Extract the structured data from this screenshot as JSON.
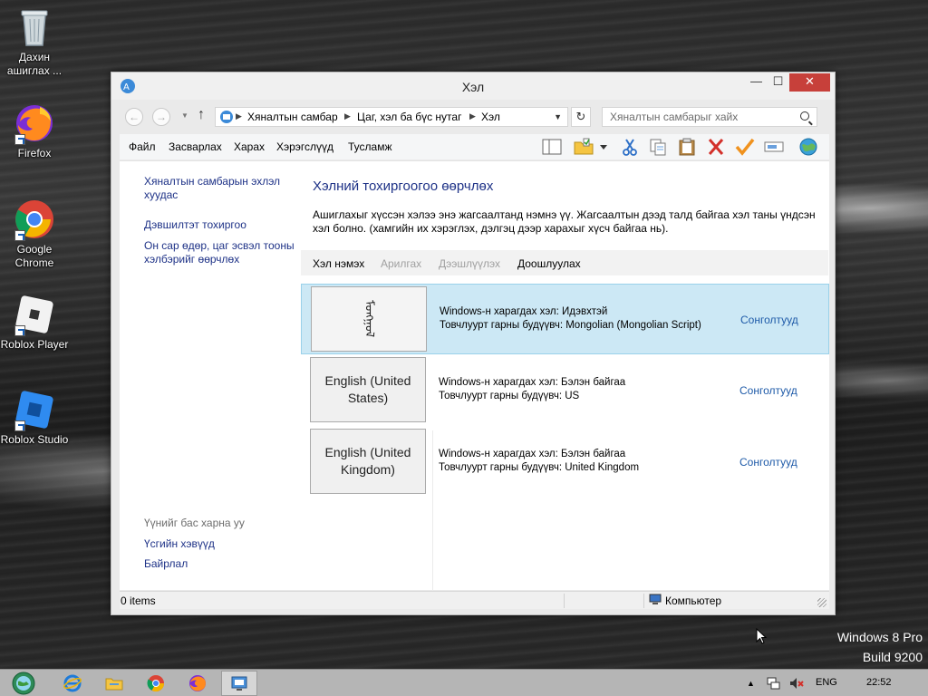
{
  "desktop": {
    "icons": [
      {
        "label": "Дахин ашиглах ..."
      },
      {
        "label": "Firefox"
      },
      {
        "label": "Google Chrome"
      },
      {
        "label": "Roblox Player"
      },
      {
        "label": "Roblox Studio"
      }
    ]
  },
  "window": {
    "title": "Хэл",
    "controls": {
      "minimize": "—",
      "maximize": "☐",
      "close": "✕"
    }
  },
  "address_bar": {
    "back": "←",
    "forward": "→",
    "up": "↑",
    "breadcrumbs": [
      "Хяналтын самбар",
      "Цаг, хэл ба бүс нутаг",
      "Хэл"
    ],
    "refresh": "↻",
    "search_placeholder": "Хяналтын самбарыг хайх"
  },
  "menu": {
    "items": [
      "Файл",
      "Засварлах",
      "Харах",
      "Хэрэгслүүд",
      "Тусламж"
    ]
  },
  "sidebar": {
    "home_link": "Хяналтын самбарын эхлэл хуудас",
    "advanced_link": "Дэвшилтэт тохиргоо",
    "date_format_link": "Он сар өдөр, цаг эсвэл тооны хэлбэрийг өөрчлөх",
    "see_also_heading": "Үүнийг бас харна уу",
    "fonts_link": "Үсгийн хэвүүд",
    "location_link": "Байрлал"
  },
  "main": {
    "title": "Хэлний тохиргоогоо өөрчлөх",
    "description": "Ашиглахыг хүссэн хэлээ энэ жагсаалтанд нэмнэ үү. Жагсаалтын дээд талд байгаа хэл таны үндсэн хэл болно. (хамгийн их хэрэглэх, дэлгэц дээр харахыг хүсч байгаа нь).",
    "commands": {
      "add": "Хэл нэмэх",
      "remove": "Арилгах",
      "move_up": "Дээшлүүлэх",
      "move_down": "Доошлуулах"
    },
    "languages": [
      {
        "button": "ᠮᠣᠩᠭᠣᠯ",
        "display": "Windows-н харагдах хэл: Идэвхтэй",
        "keyboard": "Товчлуурт гарны будүүвч: Mongolian (Mongolian Script)",
        "options": "Сонголтууд",
        "selected": true
      },
      {
        "button": "English (United States)",
        "display": "Windows-н харагдах хэл: Бэлэн байгаа",
        "keyboard": "Товчлуурт гарны будүүвч: US",
        "options": "Сонголтууд",
        "selected": false
      },
      {
        "button": "English (United Kingdom)",
        "display": "Windows-н харагдах хэл: Бэлэн байгаа",
        "keyboard": "Товчлуурт гарны будүүвч: United Kingdom",
        "options": "Сонголтууд",
        "selected": false
      }
    ]
  },
  "status": {
    "items": "0 items",
    "location": "Компьютер"
  },
  "watermark": {
    "edition": "Windows 8 Pro",
    "build": "Build 9200"
  },
  "taskbar": {
    "language": "ENG",
    "time": "22:52",
    "tray_arrow": "▲"
  },
  "colors": {
    "link": "#1e3287",
    "selection_bg": "#cce8f5",
    "close_button": "#c7403a"
  }
}
